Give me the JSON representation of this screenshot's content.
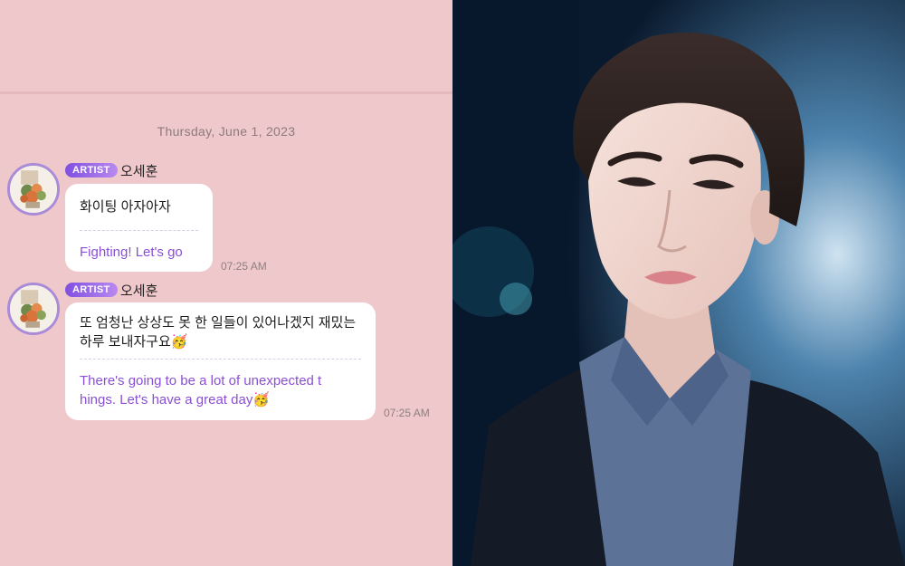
{
  "chat": {
    "date_separator": "Thursday, June 1, 2023",
    "messages": [
      {
        "badge": "ARTIST",
        "sender": "오세훈",
        "original": "화이팅 아자아자",
        "translation": "Fighting! Let's go",
        "time": "07:25 AM"
      },
      {
        "badge": "ARTIST",
        "sender": "오세훈",
        "original_line1": "또 엄청난 상상도 못 한 일들이 있어나겠지 재밌는",
        "original_line2": "하루 보내자구요🥳",
        "translation_line1": "There's going to be a lot of unexpected t",
        "translation_line2": "hings. Let's have a great day🥳",
        "time": "07:25 AM"
      }
    ]
  },
  "colors": {
    "chat_background": "#efc8cb",
    "badge_start": "#7f4fe0",
    "badge_end": "#b98af0",
    "translation_text": "#8a4fd6",
    "photo_background": "#0b1e33"
  },
  "photo": {
    "subject": "portrait-photo"
  }
}
